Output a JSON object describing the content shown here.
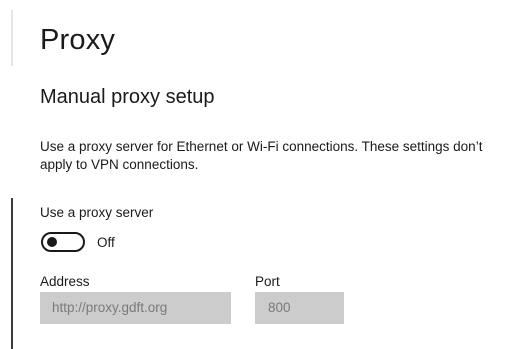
{
  "page": {
    "title": "Proxy"
  },
  "manual_setup": {
    "heading": "Manual proxy setup",
    "description": "Use a proxy server for Ethernet or Wi-Fi connections. These settings don’t apply to VPN connections.",
    "use_proxy": {
      "label": "Use a proxy server",
      "state": "Off",
      "enabled": false
    },
    "address": {
      "label": "Address",
      "value": "http://proxy.gdft.org",
      "disabled": true
    },
    "port": {
      "label": "Port",
      "value": "800",
      "disabled": true
    }
  },
  "colors": {
    "field_disabled_bg": "#cccccc",
    "field_disabled_text": "#7a7a7a",
    "text": "#1a1a1a"
  }
}
